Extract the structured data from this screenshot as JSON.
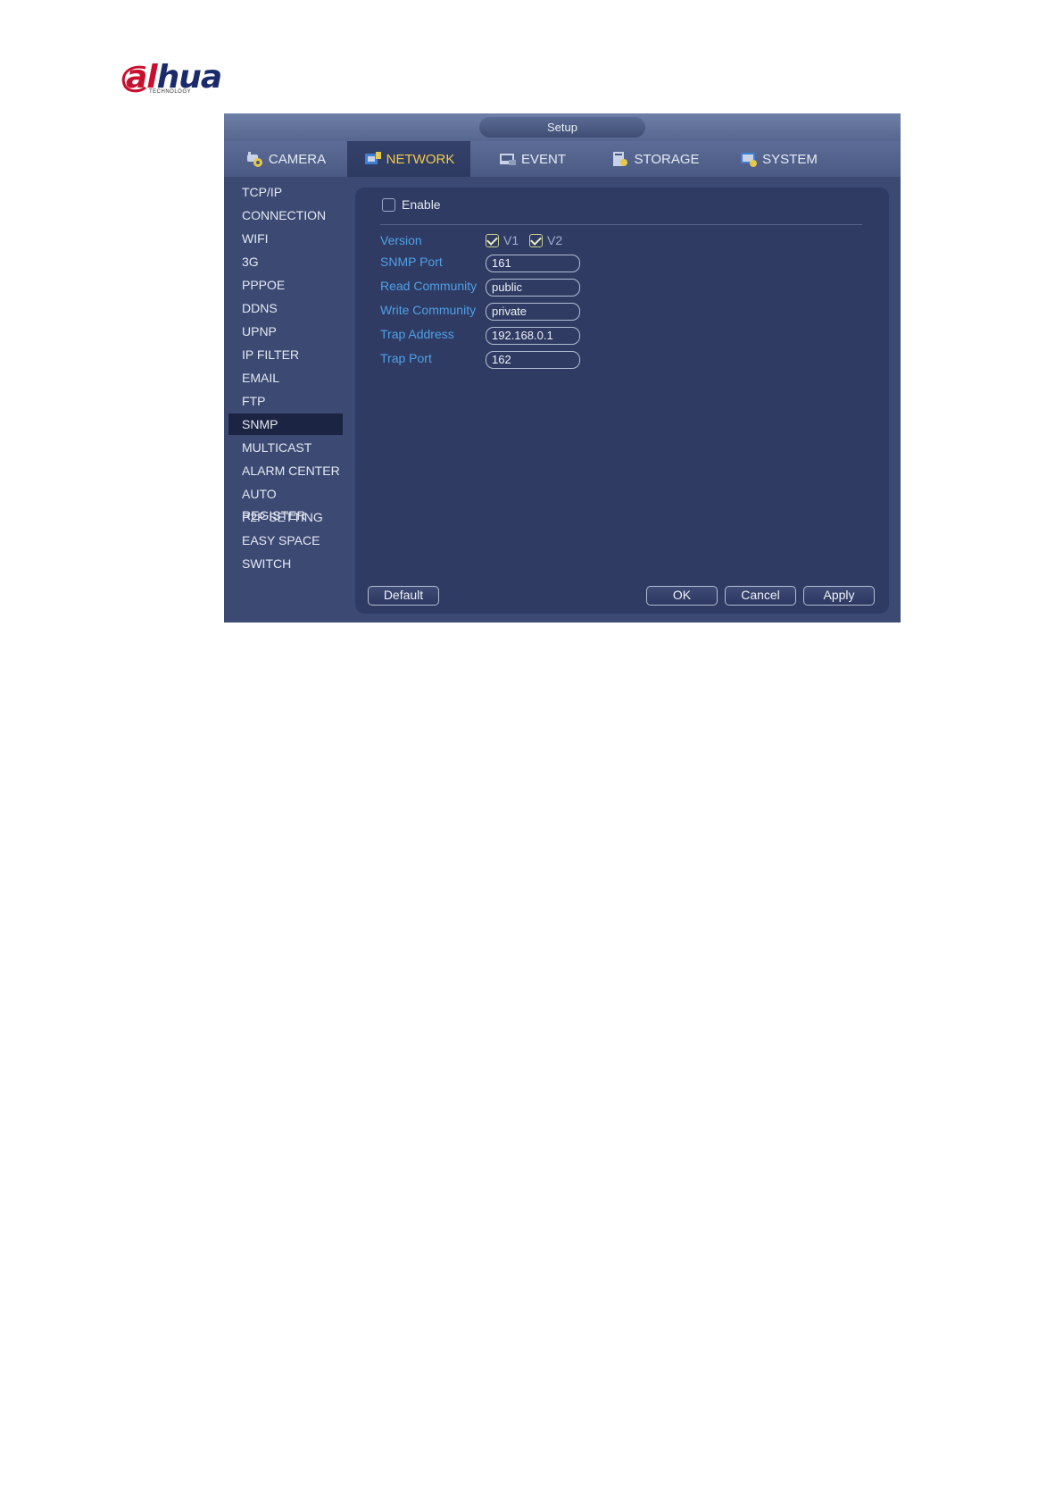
{
  "logo": {
    "accent": "#c8102e",
    "brand": "#1b2a6b"
  },
  "window": {
    "title": "Setup"
  },
  "tabs": [
    {
      "label": "CAMERA",
      "icon": "camera-icon"
    },
    {
      "label": "NETWORK",
      "icon": "network-icon",
      "active": true
    },
    {
      "label": "EVENT",
      "icon": "event-icon"
    },
    {
      "label": "STORAGE",
      "icon": "storage-icon"
    },
    {
      "label": "SYSTEM",
      "icon": "system-icon"
    }
  ],
  "sidebar": {
    "items": [
      "TCP/IP",
      "CONNECTION",
      "WIFI",
      "3G",
      "PPPOE",
      "DDNS",
      "UPNP",
      "IP FILTER",
      "EMAIL",
      "FTP",
      "SNMP",
      "MULTICAST",
      "ALARM CENTER",
      "AUTO REGISTER",
      "P2P SETTING",
      "EASY SPACE",
      "SWITCH"
    ],
    "active": "SNMP"
  },
  "snmp": {
    "enable_label": "Enable",
    "enable_checked": false,
    "version_label": "Version",
    "v1_label": "V1",
    "v1_checked": true,
    "v2_label": "V2",
    "v2_checked": true,
    "snmp_port_label": "SNMP Port",
    "snmp_port_value": "161",
    "read_community_label": "Read Community",
    "read_community_value": "public",
    "write_community_label": "Write Community",
    "write_community_value": "private",
    "trap_address_label": "Trap Address",
    "trap_address_value": "192.168.0.1",
    "trap_port_label": "Trap Port",
    "trap_port_value": "162"
  },
  "buttons": {
    "default_label": "Default",
    "ok_label": "OK",
    "cancel_label": "Cancel",
    "apply_label": "Apply"
  },
  "colors": {
    "label_blue": "#4fa0e8",
    "active_tab_text": "#f2c94c",
    "panel_bg": "#2f3b62"
  }
}
